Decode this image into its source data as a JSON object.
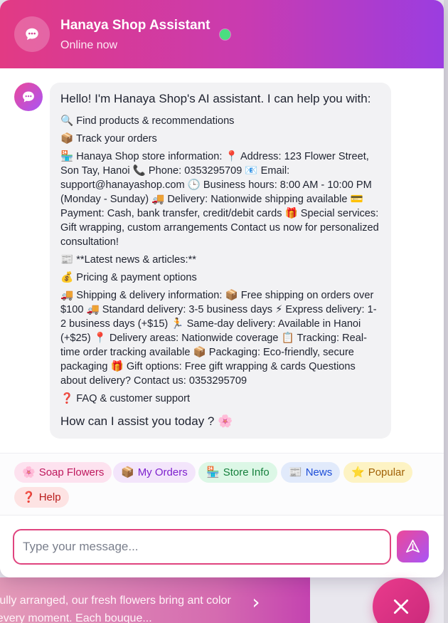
{
  "header": {
    "title": "Hanaya Shop Assistant",
    "status": "Online now",
    "avatar_icon": "chat-bubble-icon",
    "status_color": "#4ade80"
  },
  "message": {
    "intro": "Hello! I'm Hanaya Shop's AI assistant. I can help you with:",
    "lines": [
      "🔍 Find products & recommendations",
      "📦 Track your orders",
      "🏪 Hanaya Shop store information: 📍 Address: 123 Flower Street, Son Tay, Hanoi 📞 Phone: 0353295709 📧 Email: support@hanayashop.com 🕒 Business hours: 8:00 AM - 10:00 PM (Monday - Sunday) 🚚 Delivery: Nationwide shipping available 💳 Payment: Cash, bank transfer, credit/debit cards 🎁 Special services: Gift wrapping, custom arrangements Contact us now for personalized consultation!",
      "📰 **Latest news & articles:**",
      "💰 Pricing & payment options",
      "🚚 Shipping & delivery information: 📦 Free shipping on orders over $100 🚚 Standard delivery: 3-5 business days ⚡ Express delivery: 1-2 business days (+$15) 🏃 Same-day delivery: Available in Hanoi (+$25) 📍 Delivery areas: Nationwide coverage 📋 Tracking: Real-time order tracking available 📦 Packaging: Eco-friendly, secure packaging 🎁 Gift options: Free gift wrapping & cards Questions about delivery? Contact us: 0353295709",
      "❓ FAQ & customer support"
    ],
    "outro": "How can I assist you today ? 🌸"
  },
  "quick_replies": [
    {
      "icon": "🌸",
      "label": "Soap Flowers"
    },
    {
      "icon": "📦",
      "label": "My Orders"
    },
    {
      "icon": "🏪",
      "label": "Store Info"
    },
    {
      "icon": "📰",
      "label": "News"
    },
    {
      "icon": "⭐",
      "label": "Popular"
    },
    {
      "icon": "❓",
      "label": "Help"
    }
  ],
  "composer": {
    "placeholder": "Type your message...",
    "value": "",
    "send_icon": "send-icon"
  },
  "background_page": {
    "banner_text": "utifully arranged, our fresh flowers bring ant color to every moment. Each bouque...",
    "next_icon": "chevron-right-icon",
    "close_icon": "close-icon"
  },
  "colors": {
    "brand_pink": "#e23a84",
    "brand_purple": "#9b3de0"
  }
}
